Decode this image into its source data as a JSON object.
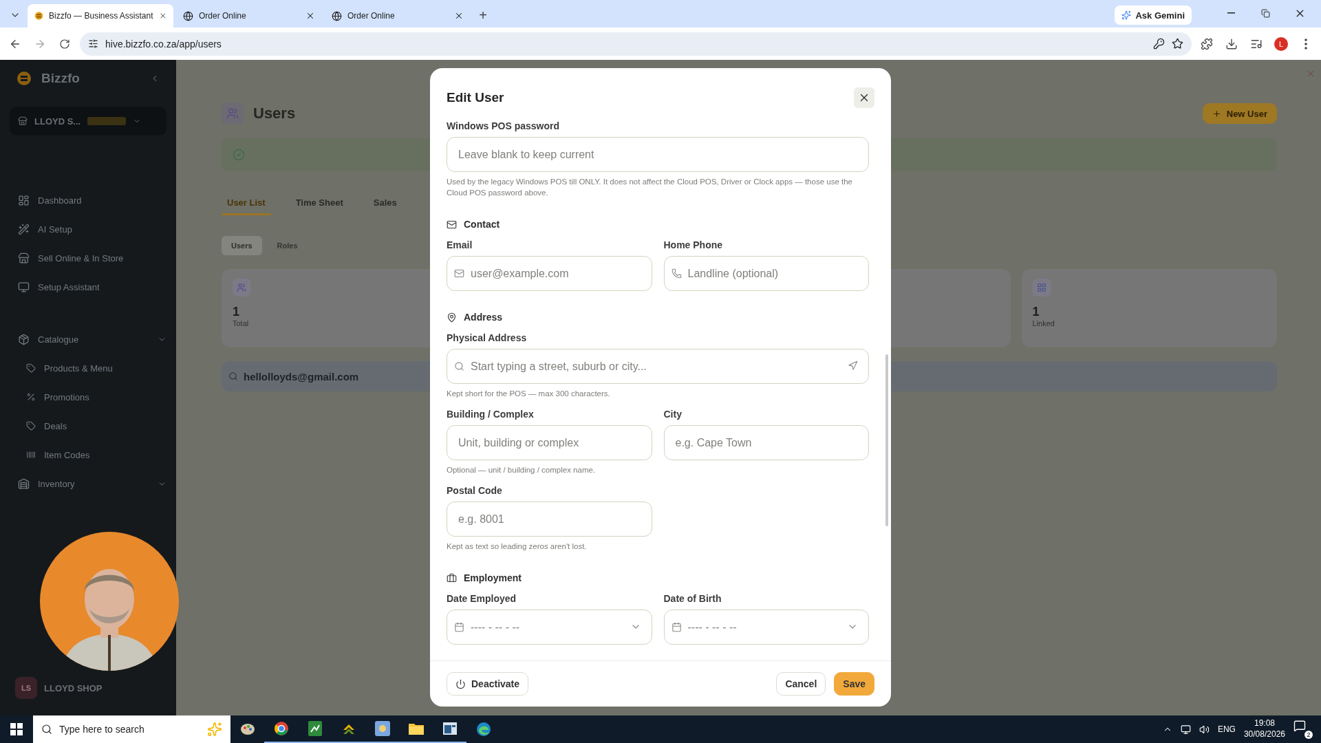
{
  "browser": {
    "tabs": [
      {
        "title": "Bizzfo — Business Assistant",
        "selected": true,
        "kind": "bizzfo"
      },
      {
        "title": "Order Online",
        "selected": false,
        "kind": "globe"
      },
      {
        "title": "Order Online",
        "selected": false,
        "kind": "globe"
      }
    ],
    "new_tab": "+",
    "ask_gemini": "Ask Gemini",
    "url": "hive.bizzfo.co.za/app/users",
    "profile_initial": "L"
  },
  "sidebar": {
    "brand": "Bizzfo",
    "store": "LLOYD S...",
    "nav": [
      {
        "label": "Dashboard",
        "kind": "item"
      },
      {
        "label": "AI Setup",
        "kind": "item"
      },
      {
        "label": "Sell Online & In Store",
        "kind": "item"
      },
      {
        "label": "Setup Assistant",
        "kind": "item"
      },
      {
        "label": "Catalogue",
        "kind": "group"
      },
      {
        "label": "Products & Menu",
        "kind": "sub"
      },
      {
        "label": "Promotions",
        "kind": "sub"
      },
      {
        "label": "Deals",
        "kind": "sub"
      },
      {
        "label": "Item Codes",
        "kind": "sub"
      },
      {
        "label": "Inventory",
        "kind": "group"
      }
    ],
    "footer_user": "LLOYD SHOP",
    "footer_initials": "LS"
  },
  "main": {
    "title": "Users",
    "new_user": "New User",
    "tabs": [
      {
        "label": "User List",
        "selected": true
      },
      {
        "label": "Time Sheet",
        "selected": false
      },
      {
        "label": "Sales",
        "selected": false
      }
    ],
    "subtabs": [
      {
        "label": "Users",
        "selected": true
      },
      {
        "label": "Roles",
        "selected": false
      }
    ],
    "stat_cards": [
      {
        "value": "1",
        "label": "Total"
      },
      {
        "value": "1",
        "label": "Linked"
      }
    ],
    "search_value": "hellolloyds@gmail.com"
  },
  "modal": {
    "title": "Edit User",
    "blocks": [
      {
        "kind": "full",
        "fields": [
          {
            "kind": "text",
            "label": "Windows POS password",
            "placeholder": "Leave blank to keep current",
            "help": "Used by the legacy Windows POS till ONLY. It does not affect the Cloud POS, Driver or Clock apps — those use the Cloud POS password above."
          }
        ]
      },
      {
        "kind": "heading",
        "label": "Contact"
      },
      {
        "kind": "pair",
        "fields": [
          {
            "kind": "email",
            "label": "Email",
            "placeholder": "user@example.com"
          },
          {
            "kind": "phone",
            "label": "Home Phone",
            "placeholder": "Landline (optional)"
          }
        ]
      },
      {
        "kind": "heading",
        "label": "Address"
      },
      {
        "kind": "full",
        "fields": [
          {
            "kind": "address",
            "label": "Physical Address",
            "placeholder": "Start typing a street, suburb or city...",
            "help": "Kept short for the POS — max 300 characters."
          }
        ]
      },
      {
        "kind": "pair",
        "fields": [
          {
            "kind": "text",
            "label": "Building / Complex",
            "placeholder": "Unit, building or complex",
            "help": "Optional — unit / building / complex name."
          },
          {
            "kind": "text",
            "label": "City",
            "placeholder": "e.g. Cape Town"
          }
        ]
      },
      {
        "kind": "pair",
        "fields": [
          {
            "kind": "text",
            "label": "Postal Code",
            "placeholder": "e.g. 8001",
            "help": "Kept as text so leading zeros aren't lost."
          }
        ]
      },
      {
        "kind": "heading",
        "label": "Employment"
      },
      {
        "kind": "pair",
        "fields": [
          {
            "kind": "date",
            "label": "Date Employed",
            "placeholder": "---- - -- - --"
          },
          {
            "kind": "date",
            "label": "Date of Birth",
            "placeholder": "---- - -- - --"
          }
        ]
      }
    ],
    "deactivate": "Deactivate",
    "cancel": "Cancel",
    "save": "Save"
  },
  "taskbar": {
    "search_placeholder": "Type here to search",
    "language": "ENG",
    "time": "19:08",
    "date": "30/08/2026",
    "notifications": "2"
  }
}
